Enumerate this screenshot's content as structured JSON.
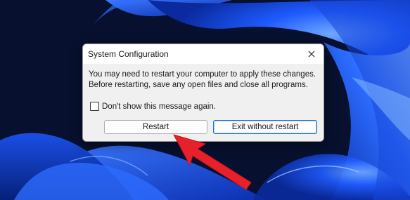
{
  "dialog": {
    "title": "System Configuration",
    "message_line1": "You may need to restart your computer to apply these changes.",
    "message_line2": "Before restarting, save any open files and close all programs.",
    "checkbox_label": "Don't show this message again.",
    "checkbox_checked": false,
    "restart_label": "Restart",
    "exit_label": "Exit without restart",
    "close_icon": "close-icon"
  },
  "annotation": {
    "arrow_color": "#e8202a",
    "points_to": "restart-button"
  },
  "colors": {
    "wallpaper_base": "#07102e",
    "wallpaper_accent": "#1f5bff",
    "default_button_border": "#1a6fc7"
  }
}
